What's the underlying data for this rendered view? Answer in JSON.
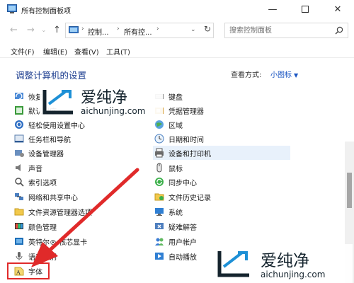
{
  "window": {
    "title": "所有控制面板项"
  },
  "address": {
    "segments": [
      "控制...",
      "所有控..."
    ],
    "search_placeholder": "搜索控制面板"
  },
  "menu": [
    "文件(F)",
    "编辑(E)",
    "查看(V)",
    "工具(T)"
  ],
  "page": {
    "heading": "调整计算机的设置",
    "view_by_label": "查看方式:",
    "view_by_value": "小图标"
  },
  "items_left": [
    {
      "label": "恢复",
      "icon": "recovery-icon"
    },
    {
      "label": "默认程序",
      "icon": "default-programs-icon"
    },
    {
      "label": "轻松使用设置中心",
      "icon": "ease-of-access-icon"
    },
    {
      "label": "任务栏和导航",
      "icon": "taskbar-icon"
    },
    {
      "label": "设备管理器",
      "icon": "device-manager-icon"
    },
    {
      "label": "声音",
      "icon": "sound-icon"
    },
    {
      "label": "索引选项",
      "icon": "indexing-icon"
    },
    {
      "label": "网络和共享中心",
      "icon": "network-icon"
    },
    {
      "label": "文件资源管理器选项",
      "icon": "folder-options-icon"
    },
    {
      "label": "颜色管理",
      "icon": "color-management-icon"
    },
    {
      "label": "英特尔® 核芯显卡",
      "icon": "intel-graphics-icon"
    },
    {
      "label": "语音识别",
      "icon": "speech-icon"
    },
    {
      "label": "字体",
      "icon": "fonts-icon"
    }
  ],
  "items_right": [
    {
      "label": "键盘",
      "icon": "keyboard-icon"
    },
    {
      "label": "凭据管理器",
      "icon": "credential-icon"
    },
    {
      "label": "区域",
      "icon": "region-icon"
    },
    {
      "label": "日期和时间",
      "icon": "date-time-icon"
    },
    {
      "label": "设备和打印机",
      "icon": "printer-icon"
    },
    {
      "label": "鼠标",
      "icon": "mouse-icon"
    },
    {
      "label": "同步中心",
      "icon": "sync-icon"
    },
    {
      "label": "文件历史记录",
      "icon": "file-history-icon"
    },
    {
      "label": "系统",
      "icon": "system-icon"
    },
    {
      "label": "疑难解答",
      "icon": "troubleshoot-icon"
    },
    {
      "label": "用户帐户",
      "icon": "user-accounts-icon"
    },
    {
      "label": "自动播放",
      "icon": "autoplay-icon"
    }
  ],
  "watermark": {
    "text": "爱纯净",
    "url": "aichunjing.com"
  },
  "colors": {
    "heading": "#1e3f90",
    "link": "#1a55c2",
    "highlight_box": "#e02a2a"
  }
}
